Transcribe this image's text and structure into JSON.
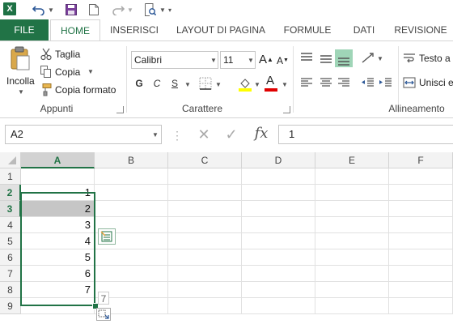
{
  "app": {
    "logo": "X"
  },
  "quick_access": [
    "excel-logo",
    "undo-icon",
    "save-icon",
    "new-file-icon",
    "redo-icon",
    "print-preview-icon"
  ],
  "tabs": [
    "FILE",
    "HOME",
    "INSERISCI",
    "LAYOUT DI PAGINA",
    "FORMULE",
    "DATI",
    "REVISIONE"
  ],
  "active_tab": "HOME",
  "ribbon": {
    "clipboard": {
      "paste_label": "Incolla",
      "cut_label": "Taglia",
      "copy_label": "Copia",
      "format_painter_label": "Copia formato",
      "group_label": "Appunti"
    },
    "font": {
      "font_name": "Calibri",
      "font_size": "11",
      "grow_label": "A",
      "shrink_label": "A",
      "bold_label": "G",
      "italic_label": "C",
      "underline_label": "S",
      "font_color_label": "A",
      "group_label": "Carattere"
    },
    "alignment": {
      "wrap_label": "Testo a",
      "merge_label": "Unisci e",
      "group_label": "Allineamento"
    }
  },
  "formula_bar": {
    "name_box": "A2",
    "cancel_symbol": "✕",
    "enter_symbol": "✓",
    "fx_label": "fx",
    "value": "1"
  },
  "grid": {
    "columns": [
      "A",
      "B",
      "C",
      "D",
      "E",
      "F"
    ],
    "selected_column": "A",
    "rows": [
      "1",
      "2",
      "3",
      "4",
      "5",
      "6",
      "7",
      "8",
      "9"
    ],
    "selected_rows": [
      "2",
      "3"
    ],
    "column_a_values": [
      "",
      "1",
      "2",
      "3",
      "4",
      "5",
      "6",
      "7",
      ""
    ],
    "fill_tooltip": "7"
  },
  "colors": {
    "accent": "#217346",
    "highlight_cell": "#c6c6c6"
  }
}
